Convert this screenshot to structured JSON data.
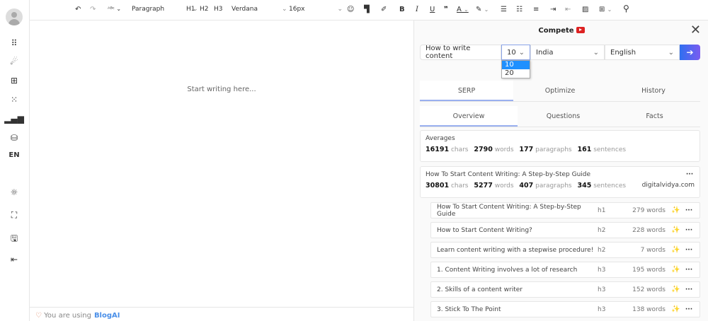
{
  "sidebar": {
    "language": "EN",
    "icons": [
      "apps-icon",
      "rocket-icon",
      "add-widget-icon",
      "dots-grid-icon",
      "bar-chart-icon",
      "database-icon",
      "sun-icon",
      "fullscreen-icon",
      "save-icon",
      "logout-icon"
    ]
  },
  "toolbar": {
    "block_format": "Paragraph",
    "h1": "H1",
    "h2": "H2",
    "h3": "H3",
    "font": "Verdana",
    "size": "16px"
  },
  "editor": {
    "placeholder": "Start writing here..."
  },
  "footer": {
    "text": "You are using",
    "brand": "BlogAI"
  },
  "panel": {
    "title": "Compete",
    "query": "How to write content",
    "count": "10",
    "count_options": [
      "10",
      "20"
    ],
    "country": "India",
    "language": "English",
    "tabs": [
      "SERP",
      "Optimize",
      "History"
    ],
    "subtabs": [
      "Overview",
      "Questions",
      "Facts"
    ],
    "averages": {
      "label": "Averages",
      "chars": "16191",
      "words": "2790",
      "paragraphs": "177",
      "sentences": "161"
    },
    "units": {
      "chars": "chars",
      "words": "words",
      "paragraphs": "paragraphs",
      "sentences": "sentences"
    },
    "result": {
      "title": "How To Start Content Writing: A Step-by-Step Guide",
      "chars": "30801",
      "words": "5277",
      "paragraphs": "407",
      "sentences": "345",
      "domain": "digitalvidya.com"
    },
    "headings": [
      {
        "text": "How To Start Content Writing: A Step-by-Step Guide",
        "level": "h1",
        "words": "279 words"
      },
      {
        "text": "How to Start Content Writing?",
        "level": "h2",
        "words": "228 words"
      },
      {
        "text": "Learn content writing with a stepwise procedure!",
        "level": "h2",
        "words": "7 words"
      },
      {
        "text": "1. Content Writing involves a lot of research",
        "level": "h3",
        "words": "195 words"
      },
      {
        "text": "2. Skills of a content writer",
        "level": "h3",
        "words": "152 words"
      },
      {
        "text": "3. Stick To The Point",
        "level": "h3",
        "words": "138 words"
      }
    ],
    "accent": "#2f6ff0"
  }
}
